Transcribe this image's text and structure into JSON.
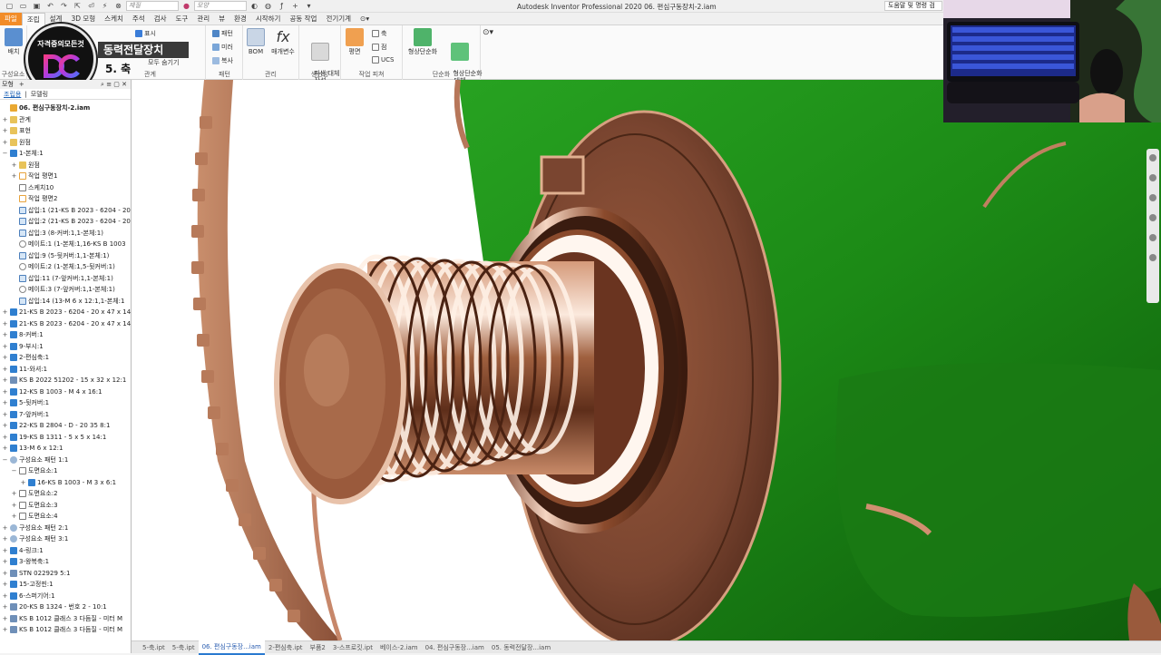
{
  "window": {
    "app_title": "Autodesk Inventor Professional 2020   06. 편심구동장치-2.iam",
    "search_text": "도움말 및 명령 검",
    "material_combo": "재질",
    "appearance_combo": "모양"
  },
  "ribbon_tabs": [
    "파일",
    "조립",
    "설계",
    "3D 모형",
    "스케치",
    "주석",
    "검사",
    "도구",
    "관리",
    "뷰",
    "환경",
    "시작하기",
    "공동 작업",
    "전기기계"
  ],
  "ribbon": {
    "place_label": "배치",
    "component_group": "구성요소",
    "show_label": "표시",
    "show_all_hide_label": "모두 숨기기",
    "relationship_group": "관계",
    "pattern_label": "패턴",
    "mirror_label": "미러",
    "copy_label": "복사",
    "pattern_group": "패턴",
    "bom_label": "BOM",
    "params_label": "매개변수",
    "manage_group": "관리",
    "derive_label": "파생 대체\n작성",
    "productivity_group": "생산성",
    "plane_label": "평면",
    "axis_label": "축",
    "point_label": "점",
    "ucs_label": "UCS",
    "workfeature_group": "작업 피쳐",
    "simplify_label": "형상단순화",
    "simplify_sub_label": "형상단순화\n대체",
    "simplify_group": "단순화"
  },
  "overlay": {
    "logo_top_text": "자격증의모든것",
    "logo_letters": "DC",
    "banner_title": "동력전달장치",
    "banner_subtitle": "5. 축"
  },
  "browser": {
    "header_model": "모형",
    "header_plus": "+",
    "tab_assembly": "조립용",
    "tab_modeling": "모델링",
    "tree": [
      {
        "depth": 0,
        "pm": "",
        "icon": "asm",
        "label": "06. 편심구동장치-2.iam",
        "bold": true
      },
      {
        "depth": 0,
        "pm": "+",
        "icon": "folder",
        "label": "관계"
      },
      {
        "depth": 0,
        "pm": "+",
        "icon": "folder",
        "label": "표현"
      },
      {
        "depth": 0,
        "pm": "+",
        "icon": "folder",
        "label": "원점"
      },
      {
        "depth": 0,
        "pm": "−",
        "icon": "part",
        "label": "1-본체:1"
      },
      {
        "depth": 1,
        "pm": "+",
        "icon": "folder",
        "label": "원점"
      },
      {
        "depth": 1,
        "pm": "+",
        "icon": "plane",
        "label": "작업 평면1"
      },
      {
        "depth": 1,
        "pm": "",
        "icon": "sketch",
        "label": "스케치10"
      },
      {
        "depth": 1,
        "pm": "",
        "icon": "plane",
        "label": "작업 평면2"
      },
      {
        "depth": 1,
        "pm": "",
        "icon": "insert",
        "label": "삽입:1 (21-KS B 2023 - 6204 - 20"
      },
      {
        "depth": 1,
        "pm": "",
        "icon": "insert",
        "label": "삽입:2 (21-KS B 2023 - 6204 - 20"
      },
      {
        "depth": 1,
        "pm": "",
        "icon": "insert",
        "label": "삽입:3 (8-커버:1,1-본체:1)"
      },
      {
        "depth": 1,
        "pm": "",
        "icon": "mate",
        "label": "메이트:1 (1-본체:1,16-KS B 1003"
      },
      {
        "depth": 1,
        "pm": "",
        "icon": "insert",
        "label": "삽입:9 (5-뒷커버:1,1-본체:1)"
      },
      {
        "depth": 1,
        "pm": "",
        "icon": "mate",
        "label": "메이트:2 (1-본체:1,5-뒷커버:1)"
      },
      {
        "depth": 1,
        "pm": "",
        "icon": "insert",
        "label": "삽입:11 (7-앞커버:1,1-본체:1)"
      },
      {
        "depth": 1,
        "pm": "",
        "icon": "mate",
        "label": "메이트:3 (7-앞커버:1,1-본체:1)"
      },
      {
        "depth": 1,
        "pm": "",
        "icon": "insert",
        "label": "삽입:14 (13-M 6 x 12:1,1-본체:1"
      },
      {
        "depth": 0,
        "pm": "+",
        "icon": "part",
        "label": "21-KS B 2023 - 6204 - 20 x 47 x 14"
      },
      {
        "depth": 0,
        "pm": "+",
        "icon": "part",
        "label": "21-KS B 2023 - 6204 - 20 x 47 x 14"
      },
      {
        "depth": 0,
        "pm": "+",
        "icon": "part",
        "label": "8-커버:1"
      },
      {
        "depth": 0,
        "pm": "+",
        "icon": "part",
        "label": "9-부시:1"
      },
      {
        "depth": 0,
        "pm": "+",
        "icon": "part",
        "label": "2-편심축:1"
      },
      {
        "depth": 0,
        "pm": "+",
        "icon": "part",
        "label": "11-와셔:1"
      },
      {
        "depth": 0,
        "pm": "+",
        "icon": "std",
        "label": "KS B 2022 51202 - 15 x 32 x 12:1"
      },
      {
        "depth": 0,
        "pm": "+",
        "icon": "part",
        "label": "12-KS B 1003 - M 4 x 16:1"
      },
      {
        "depth": 0,
        "pm": "+",
        "icon": "part",
        "label": "5-뒷커버:1"
      },
      {
        "depth": 0,
        "pm": "+",
        "icon": "part",
        "label": "7-앞커버:1"
      },
      {
        "depth": 0,
        "pm": "+",
        "icon": "part",
        "label": "22-KS B 2804 - D - 20 35 8:1"
      },
      {
        "depth": 0,
        "pm": "+",
        "icon": "part",
        "label": "19-KS B 1311 - 5 x 5 x 14:1"
      },
      {
        "depth": 0,
        "pm": "+",
        "icon": "part",
        "label": "13-M 6 x 12:1"
      },
      {
        "depth": 0,
        "pm": "−",
        "icon": "pattern",
        "label": "구성요소 패턴 1:1"
      },
      {
        "depth": 1,
        "pm": "−",
        "icon": "sketch",
        "label": "도면요소:1"
      },
      {
        "depth": 2,
        "pm": "+",
        "icon": "part",
        "label": "16-KS B 1003 - M 3 x 6:1"
      },
      {
        "depth": 1,
        "pm": "+",
        "icon": "sketch",
        "label": "도면요소:2"
      },
      {
        "depth": 1,
        "pm": "+",
        "icon": "sketch",
        "label": "도면요소:3"
      },
      {
        "depth": 1,
        "pm": "+",
        "icon": "sketch",
        "label": "도면요소:4"
      },
      {
        "depth": 0,
        "pm": "+",
        "icon": "pattern",
        "label": "구성요소 패턴 2:1"
      },
      {
        "depth": 0,
        "pm": "+",
        "icon": "pattern",
        "label": "구성요소 패턴 3:1"
      },
      {
        "depth": 0,
        "pm": "+",
        "icon": "part",
        "label": "4-링크:1"
      },
      {
        "depth": 0,
        "pm": "+",
        "icon": "part",
        "label": "3-왕복축:1"
      },
      {
        "depth": 0,
        "pm": "+",
        "icon": "std",
        "label": "STN 022929 5:1"
      },
      {
        "depth": 0,
        "pm": "+",
        "icon": "part",
        "label": "15-고정핀:1"
      },
      {
        "depth": 0,
        "pm": "+",
        "icon": "part",
        "label": "6-스퍼기어:1"
      },
      {
        "depth": 0,
        "pm": "+",
        "icon": "std",
        "label": "20-KS B 1324 - 번호 2 - 10:1"
      },
      {
        "depth": 0,
        "pm": "+",
        "icon": "std",
        "label": "KS B 1012 클래스 3 다듬질 - 미터 M"
      },
      {
        "depth": 0,
        "pm": "+",
        "icon": "std",
        "label": "KS B 1012 클래스 3 다듬질 - 미터 M"
      }
    ]
  },
  "doc_tabs": [
    {
      "label": "5-축.ipt",
      "active": false
    },
    {
      "label": "5-축.ipt",
      "active": false
    },
    {
      "label": "06. 편심구동장...iam",
      "active": true
    },
    {
      "label": "2-편심축.ipt",
      "active": false
    },
    {
      "label": "부품2",
      "active": false
    },
    {
      "label": "3-스프로킷.ipt",
      "active": false
    },
    {
      "label": "베이스-2.iam",
      "active": false
    },
    {
      "label": "04. 편심구동장...iam",
      "active": false
    },
    {
      "label": "05. 동력전달장...iam",
      "active": false
    }
  ],
  "colors": {
    "file_tab": "#f28c28",
    "body_green": "#1f8a1a",
    "copper": "#b06a45",
    "accent_blue": "#2a7ad0"
  }
}
